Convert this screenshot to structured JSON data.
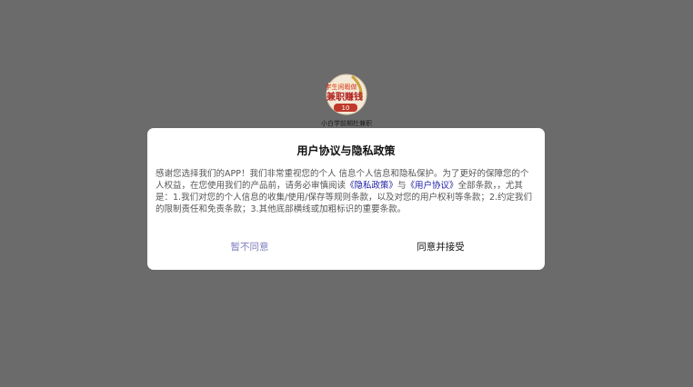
{
  "splash": {
    "app_name": "小白学前期杜兼职",
    "logo_text_line1": "学生闲暇做",
    "logo_text_line2": "兼职赚钱",
    "logo_badge": "10"
  },
  "dialog": {
    "title": "用户协议与隐私政策",
    "body_part1": "感谢您选择我们的APP！我们非常重视您的个人 信息个人信息和隐私保护。为了更好的保障您的个 人权益，在您使用我们的产品前，请务必审慎阅读",
    "privacy_link": "《隐私政策》",
    "connector": "与",
    "user_agreement_link": "《用户协议》",
    "body_part2": "全部条款，，尤其是：1.我们对您的个人信息的收集/使用/保存等规则条款，以及对您的用户权利等条款；2.约定我们的限制责任和免责条款；3.其他底部横线或加粗标识的重要条款。",
    "disagree_label": "暂不同意",
    "accept_label": "同意并接受"
  },
  "colors": {
    "overlay": "#6b6b6b",
    "dialog_bg": "#ffffff",
    "link": "#1a1aa6",
    "disagree": "#7d7dbf",
    "logo_red": "#c0392b"
  }
}
